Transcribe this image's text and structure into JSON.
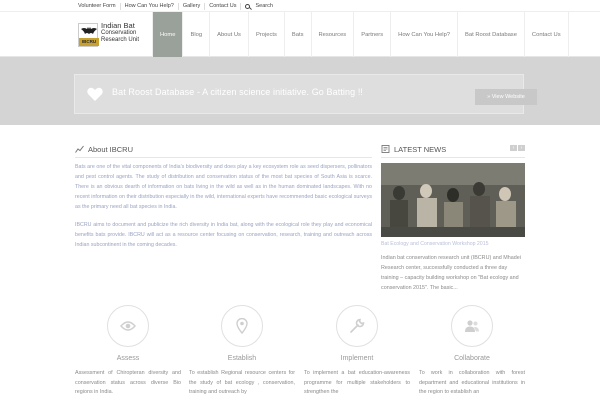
{
  "topbar": {
    "links": [
      "Volunteer Form",
      "How Can You Help?",
      "Gallery",
      "Contact Us"
    ],
    "search_label": "Search"
  },
  "logo": {
    "line1": "Indian Bat",
    "line2": "Conservation",
    "line3": "Research Unit",
    "badge": "IBCRU"
  },
  "nav": {
    "items": [
      "Home",
      "Blog",
      "About Us",
      "Projects",
      "Bats",
      "Resources",
      "Partners",
      "How Can You Help?",
      "Bat Roost Database",
      "Contact Us"
    ],
    "active": "Home"
  },
  "banner": {
    "text": "Bat Roost Database - A citizen science initiative. Go Batting !!",
    "button": "» View Website"
  },
  "about": {
    "title": "About IBCRU",
    "p1": "Bats are one of the vital components of India's biodiversity and does play a key ecosystem role as seed dispersers, pollinators and pest control agents. The study of distribution and conservation status of the most bat species of South Asia is scarce. There is an obvious dearth of information on bats living in the wild as well as in the human dominated landscapes. With no recent information on their distribution especially in the wild, international experts have recommended basic ecological surveys as the primary need all bat species in India.",
    "p2": "IBCRU aims to document and publicize the rich diversity in India bat, along with the ecological role they play and economical benefits bats provide. IBCRU will act as a resource center focusing on conservation, research, training and outreach across Indian subcontinent in the coming decades."
  },
  "news": {
    "title": "LATEST NEWS",
    "prev": "‹",
    "next": "›",
    "caption": "Bat Ecology and Conservation Workshop 2015",
    "text": "Indian bat conservation research unit (IBCRU) and Mhadei Research center, successfully conducted a three day training – capacity building workshop on \"Bat ecology and conservation 2015\". The basic..."
  },
  "features": [
    {
      "icon": "eye-icon",
      "title": "Assess",
      "text": "Assessment of Chiropteran diversity and conservation status across diverse Bio regions in India."
    },
    {
      "icon": "map-pin-icon",
      "title": "Establish",
      "text": "To establish Regional resource centers for the study of bat ecology , conservation, training and outreach by"
    },
    {
      "icon": "wrench-icon",
      "title": "Implement",
      "text": "To implement a bat education-awareness programme for multiple stakeholders to strengthen the"
    },
    {
      "icon": "users-icon",
      "title": "Collaborate",
      "text": "To work in collaboration with forest department and educational institutions in the region to establish an"
    }
  ],
  "colors": {
    "nav_active": "#9aa09a",
    "banner_bg": "#d4d4d4",
    "about_text": "#9aa3c2"
  }
}
